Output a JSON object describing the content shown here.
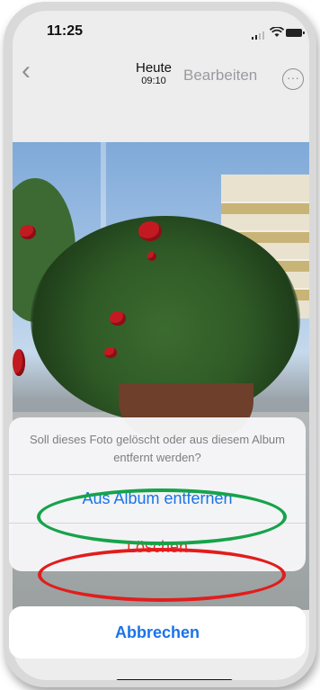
{
  "status_bar": {
    "time": "11:25"
  },
  "nav": {
    "title": "Heute",
    "subtitle": "09:10",
    "edit_label": "Bearbeiten",
    "more_glyph": "···",
    "back_glyph": "‹"
  },
  "action_sheet": {
    "message": "Soll dieses Foto gelöscht oder aus diesem Album entfernt werden?",
    "remove_label": "Aus Album entfernen",
    "delete_label": "Löschen",
    "cancel_label": "Abbrechen"
  },
  "annotations": {
    "green_color": "#16a34a",
    "red_color": "#e11d1d"
  },
  "colors": {
    "accent": "#1a73e8",
    "destructive": "#e8332f"
  }
}
